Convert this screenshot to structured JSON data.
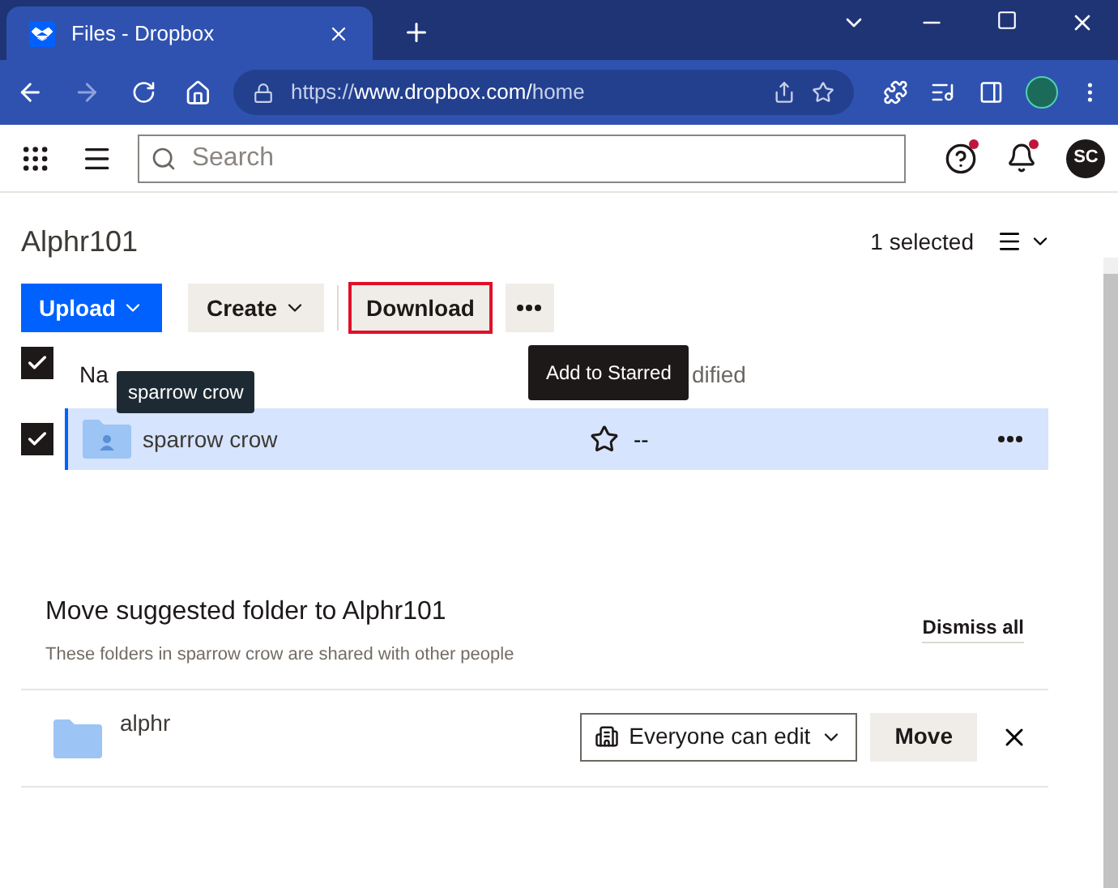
{
  "browser": {
    "tab_title": "Files - Dropbox",
    "url_scheme": "https://",
    "url_host": "www.dropbox.com/",
    "url_path": "home"
  },
  "header": {
    "search_placeholder": "Search",
    "avatar": "SC",
    "help_alert": true,
    "notification_alert": true
  },
  "folder": {
    "title": "Alphr101",
    "selection_count": "1 selected"
  },
  "toolbar": {
    "upload": "Upload",
    "create": "Create",
    "download": "Download"
  },
  "table": {
    "all_checked": true,
    "columns": [
      "Na",
      "dified"
    ],
    "rows": [
      {
        "name": "sparrow crow",
        "modified": "--",
        "selected": true
      }
    ]
  },
  "tooltips": [
    {
      "text": "sparrow crow"
    },
    {
      "text": "Add to Starred"
    }
  ],
  "suggestion": {
    "title": "Move suggested folder to Alphr101",
    "subtitle": "These folders in sparrow crow are shared with other people",
    "dismiss": "Dismiss all",
    "items": [
      {
        "name": "alphr",
        "permission": "Everyone can edit",
        "action": "Move"
      }
    ]
  }
}
